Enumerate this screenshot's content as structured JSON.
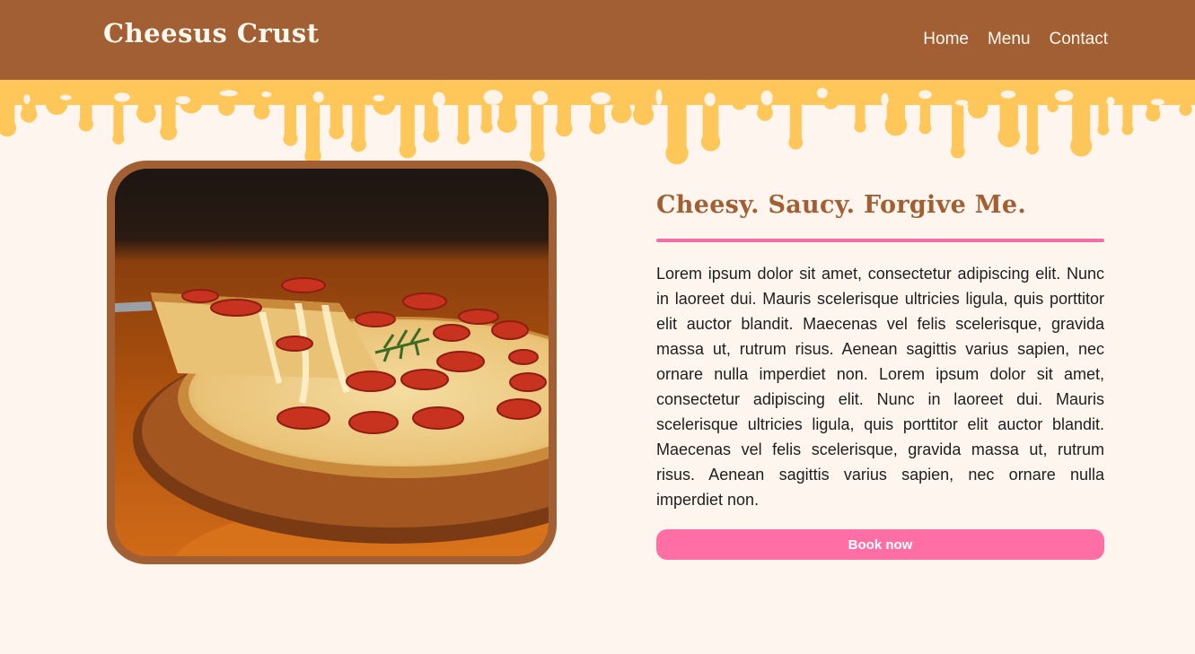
{
  "brand": {
    "name": "Cheesus Crust"
  },
  "nav": {
    "items": [
      {
        "label": "Home"
      },
      {
        "label": "Menu"
      },
      {
        "label": "Contact"
      }
    ]
  },
  "hero": {
    "headline": "Cheesy. Saucy. Forgive Me.",
    "body": "Lorem ipsum dolor sit amet, consectetur adipiscing elit. Nunc in laoreet dui. Mauris scelerisque ultricies ligula, quis porttitor elit auctor blandit. Maecenas vel felis scelerisque, gravida massa ut, rutrum risus. Aenean sagittis varius sapien, nec ornare nulla imperdiet non. Lorem ipsum dolor sit amet, consectetur adipiscing elit. Nunc in laoreet dui. Mauris scelerisque ultricies ligula, quis porttitor elit auctor blandit. Maecenas vel felis scelerisque, gravida massa ut, rutrum risus. Aenean sagittis varius sapien, nec ornare nulla imperdiet non.",
    "cta_label": "Book now",
    "image": "pepperoni-pizza-photo"
  },
  "colors": {
    "header_bg": "#a25f33",
    "page_bg": "#fef6ee",
    "cheese_drip": "#ffc65a",
    "accent_pink": "#ff6fa5",
    "headline_brown": "#a25f33"
  }
}
